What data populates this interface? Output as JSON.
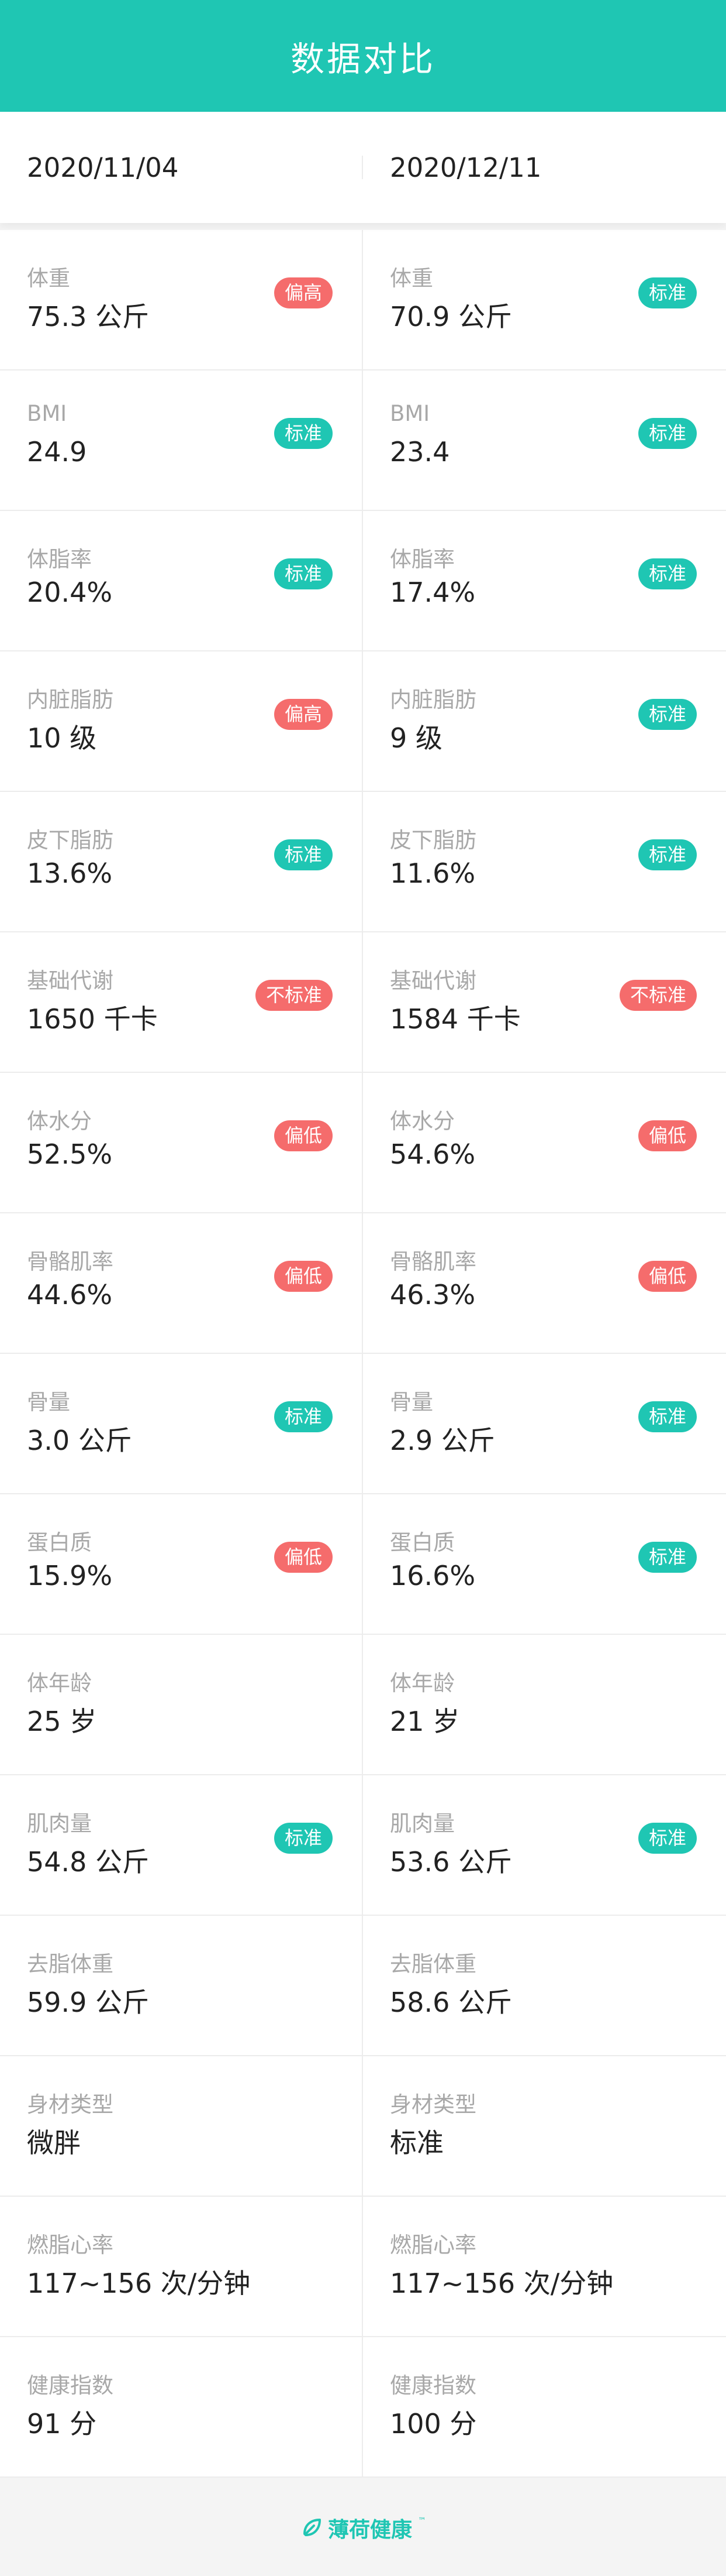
{
  "header": {
    "title": "数据对比"
  },
  "dates": {
    "left": "2020/11/04",
    "right": "2020/12/11"
  },
  "colors": {
    "accent": "#1fc6b3",
    "standard": "#1fc6b3",
    "high": "#f56c6c",
    "low": "#f56c6c",
    "nonstandard": "#f56c6c"
  },
  "rows": [
    {
      "label": "体重",
      "left": {
        "value": "75.3 公斤",
        "badge": "偏高",
        "tone": "warn"
      },
      "right": {
        "value": "70.9 公斤",
        "badge": "标准",
        "tone": "ok"
      }
    },
    {
      "label": "BMI",
      "left": {
        "value": "24.9",
        "badge": "标准",
        "tone": "ok"
      },
      "right": {
        "value": "23.4",
        "badge": "标准",
        "tone": "ok"
      }
    },
    {
      "label": "体脂率",
      "left": {
        "value": "20.4%",
        "badge": "标准",
        "tone": "ok"
      },
      "right": {
        "value": "17.4%",
        "badge": "标准",
        "tone": "ok"
      }
    },
    {
      "label": "内脏脂肪",
      "left": {
        "value": "10 级",
        "badge": "偏高",
        "tone": "warn"
      },
      "right": {
        "value": "9 级",
        "badge": "标准",
        "tone": "ok"
      }
    },
    {
      "label": "皮下脂肪",
      "left": {
        "value": "13.6%",
        "badge": "标准",
        "tone": "ok"
      },
      "right": {
        "value": "11.6%",
        "badge": "标准",
        "tone": "ok"
      }
    },
    {
      "label": "基础代谢",
      "left": {
        "value": "1650 千卡",
        "badge": "不标准",
        "tone": "warn"
      },
      "right": {
        "value": "1584 千卡",
        "badge": "不标准",
        "tone": "warn"
      }
    },
    {
      "label": "体水分",
      "left": {
        "value": "52.5%",
        "badge": "偏低",
        "tone": "warn"
      },
      "right": {
        "value": "54.6%",
        "badge": "偏低",
        "tone": "warn"
      }
    },
    {
      "label": "骨骼肌率",
      "left": {
        "value": "44.6%",
        "badge": "偏低",
        "tone": "warn"
      },
      "right": {
        "value": "46.3%",
        "badge": "偏低",
        "tone": "warn"
      }
    },
    {
      "label": "骨量",
      "left": {
        "value": "3.0 公斤",
        "badge": "标准",
        "tone": "ok"
      },
      "right": {
        "value": "2.9 公斤",
        "badge": "标准",
        "tone": "ok"
      }
    },
    {
      "label": "蛋白质",
      "left": {
        "value": "15.9%",
        "badge": "偏低",
        "tone": "warn"
      },
      "right": {
        "value": "16.6%",
        "badge": "标准",
        "tone": "ok"
      }
    },
    {
      "label": "体年龄",
      "left": {
        "value": "25 岁",
        "badge": "",
        "tone": ""
      },
      "right": {
        "value": "21 岁",
        "badge": "",
        "tone": ""
      }
    },
    {
      "label": "肌肉量",
      "left": {
        "value": "54.8 公斤",
        "badge": "标准",
        "tone": "ok"
      },
      "right": {
        "value": "53.6 公斤",
        "badge": "标准",
        "tone": "ok"
      }
    },
    {
      "label": "去脂体重",
      "left": {
        "value": "59.9 公斤",
        "badge": "",
        "tone": ""
      },
      "right": {
        "value": "58.6 公斤",
        "badge": "",
        "tone": ""
      }
    },
    {
      "label": "身材类型",
      "left": {
        "value": "微胖",
        "badge": "",
        "tone": ""
      },
      "right": {
        "value": "标准",
        "badge": "",
        "tone": ""
      }
    },
    {
      "label": "燃脂心率",
      "left": {
        "value": "117~156 次/分钟",
        "badge": "",
        "tone": ""
      },
      "right": {
        "value": "117~156 次/分钟",
        "badge": "",
        "tone": ""
      }
    },
    {
      "label": "健康指数",
      "left": {
        "value": "91 分",
        "badge": "",
        "tone": ""
      },
      "right": {
        "value": "100 分",
        "badge": "",
        "tone": ""
      }
    }
  ],
  "footer": {
    "brand": "薄荷健康",
    "trademark": "™",
    "logo_icon": "mint-leaf-icon"
  }
}
